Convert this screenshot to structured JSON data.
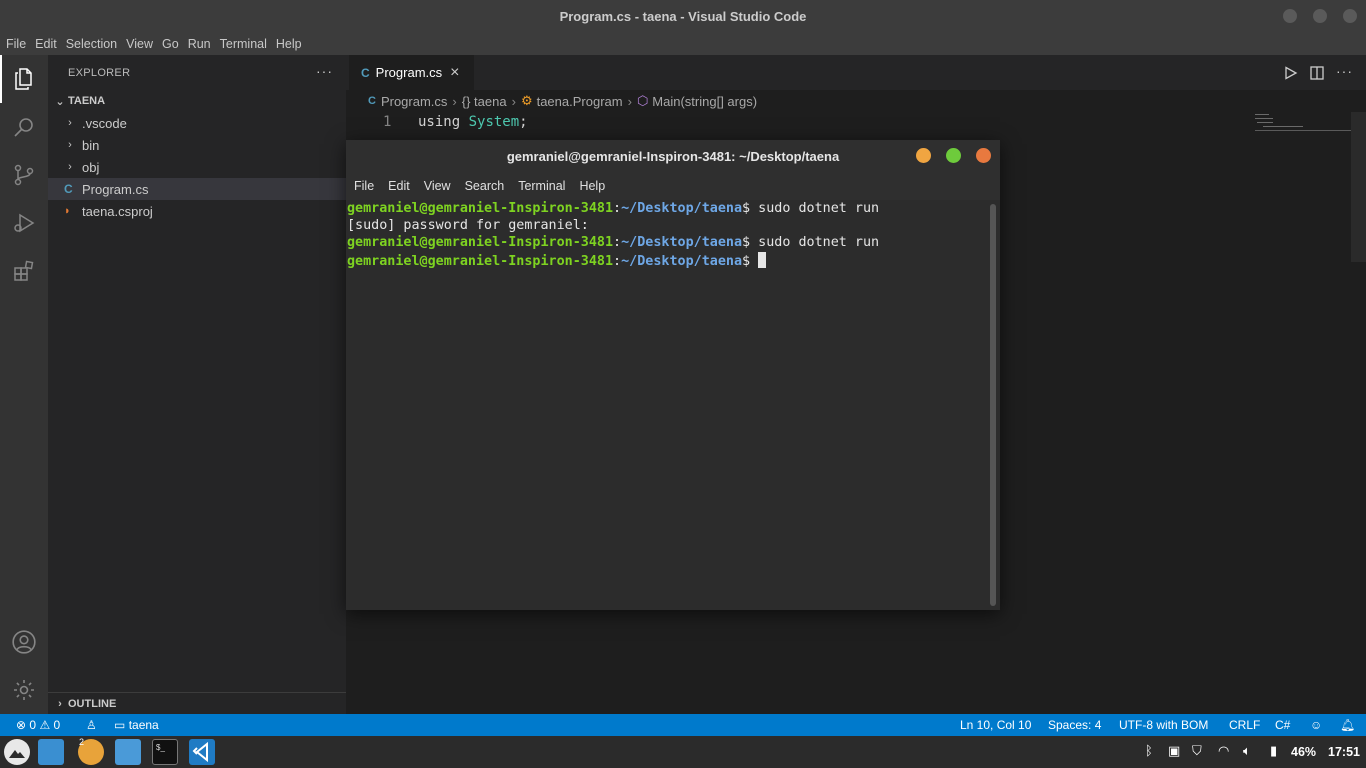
{
  "window": {
    "title": "Program.cs - taena - Visual Studio Code"
  },
  "menu": [
    "File",
    "Edit",
    "Selection",
    "View",
    "Go",
    "Run",
    "Terminal",
    "Help"
  ],
  "sidebar": {
    "header": "EXPLORER",
    "more": "···",
    "project": "TAENA",
    "items": [
      {
        "label": ".vscode",
        "type": "folder"
      },
      {
        "label": "bin",
        "type": "folder"
      },
      {
        "label": "obj",
        "type": "folder"
      },
      {
        "label": "Program.cs",
        "type": "file-cs"
      },
      {
        "label": "taena.csproj",
        "type": "file-xml"
      }
    ],
    "outline": "OUTLINE"
  },
  "editor": {
    "tab": {
      "label": "Program.cs",
      "close": "×"
    },
    "breadcrumb": [
      "Program.cs",
      "{} taena",
      "taena.Program",
      "Main(string[] args)"
    ],
    "line_number": "1",
    "code_keyword": "using",
    "code_type": "System",
    "code_end": ";"
  },
  "terminal": {
    "title": "gemraniel@gemraniel-Inspiron-3481: ~/Desktop/taena",
    "menu": [
      "File",
      "Edit",
      "View",
      "Search",
      "Terminal",
      "Help"
    ],
    "user": "gemraniel@gemraniel-Inspiron-3481",
    "path": "~/Desktop/taena",
    "lines": [
      {
        "prompt": true,
        "cmd": "$ sudo dotnet run"
      },
      {
        "prompt": false,
        "text": "[sudo] password for gemraniel:"
      },
      {
        "prompt": true,
        "cmd": "$ sudo dotnet run"
      },
      {
        "prompt": true,
        "cmd": "$ "
      }
    ]
  },
  "status": {
    "errors": "0",
    "warnings": "0",
    "folder": "taena",
    "position": "Ln 10, Col 10",
    "spaces": "Spaces: 4",
    "encoding": "UTF-8 with BOM",
    "eol": "CRLF",
    "language": "C#"
  },
  "taskbar": {
    "badge": "2",
    "battery": "46%",
    "clock": "17:51"
  },
  "colors": {
    "accent": "#007acc",
    "prompt_user": "#7ed321",
    "prompt_path": "#6ea7e6",
    "dot_min": "#f0a541",
    "dot_max": "#6ecb3c",
    "dot_close": "#e8793f"
  }
}
